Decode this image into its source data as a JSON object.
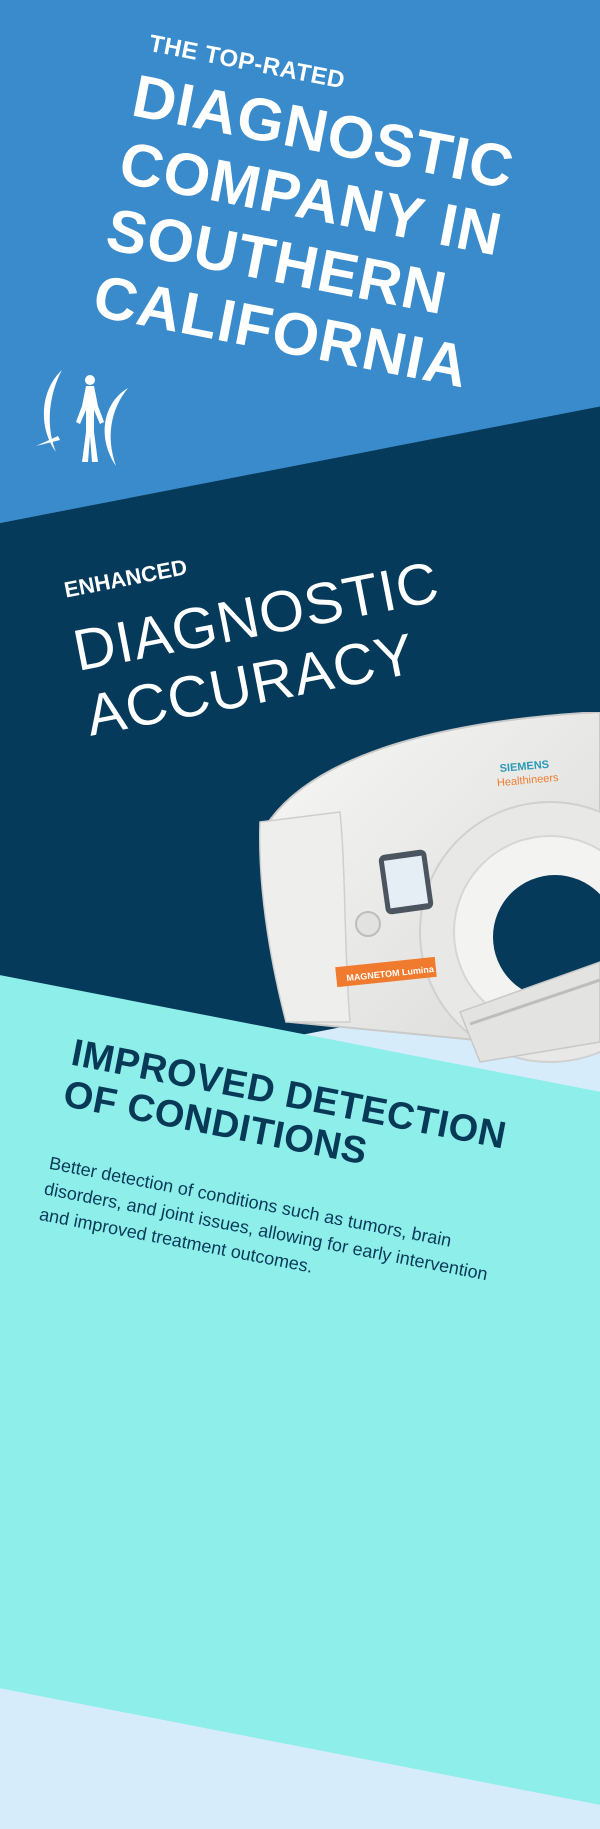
{
  "hero": {
    "kicker": "THE TOP-RATED",
    "headline_lines": [
      "DIAGNOSTIC",
      "COMPANY IN",
      "SOUTHERN",
      "CALIFORNIA"
    ],
    "logo_icon": "human-figure-logo-icon"
  },
  "section_two": {
    "kicker": "ENHANCED",
    "title_lines": [
      "DIAGNOSTIC",
      "ACCURACY"
    ],
    "image": {
      "icon": "mri-scanner-image",
      "brand_line1": "SIEMENS",
      "brand_line2": "Healthineers",
      "model_label": "MAGNETOM Lumina"
    }
  },
  "section_three": {
    "title_lines": [
      "IMPROVED DETECTION",
      "OF CONDITIONS"
    ],
    "body": "Better detection of conditions such as tumors, brain disorders, and joint issues, allowing for early intervention and improved treatment outcomes."
  },
  "colors": {
    "light_background": "#d6ecfb",
    "blue_band": "#3a8bcb",
    "navy_band": "#053a5a",
    "cyan_band": "#8eeeea",
    "text_dark": "#083a58",
    "text_light": "#ffffff"
  }
}
